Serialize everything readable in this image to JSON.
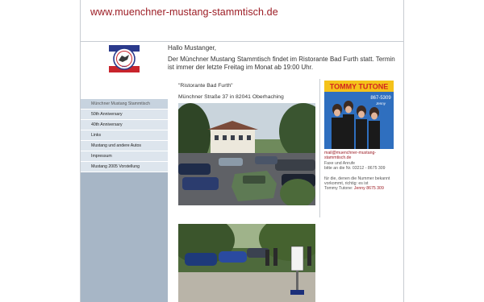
{
  "header": {
    "site_url": "www.muenchner-mustang-stammtisch.de"
  },
  "intro": {
    "greeting": "Hallo Mustanger,",
    "text": "Der Münchner Mustang Stammtisch findet im Ristorante Bad Furth statt. Termin ist immer der letzte Freitag im Monat ab 19:00 Uhr."
  },
  "venue": {
    "name": "\"Ristorante Bad Furth\"",
    "address": "Münchner Straße 37 in 82041 Oberhaching"
  },
  "nav": {
    "items": [
      "Münchner Mustang Stammtisch",
      "50th Anniversary",
      "40th Anniversary",
      "Links",
      "Mustang und andere Autos",
      "Impressum",
      "Mustang 2005 Vorstellung"
    ]
  },
  "banner": {
    "title": "TOMMY TUTONE",
    "subtitle": "867-5309",
    "tagline": "Jenny"
  },
  "contact": {
    "email": "mail@muenchner-mustang-stammtisch.de",
    "line1": "Faxe und Anrufe",
    "line2": "bitte an die Nr. 03212 - 8675 309",
    "line3": "für die, denen die Nummer bekannt",
    "line4": "vorkommt, richtig: es ist",
    "line5_prefix": "Tommy Tutone: ",
    "line5_link": "Jenny 8675 309"
  },
  "colors": {
    "accent": "#9c1c24",
    "sidebar": "#a7b6c6",
    "nav_item": "#dde5ed"
  }
}
